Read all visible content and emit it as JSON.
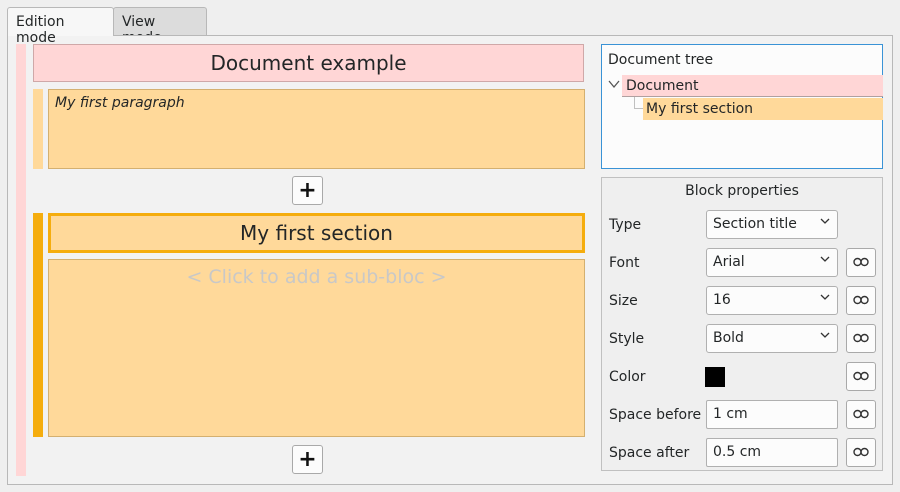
{
  "tabs": [
    {
      "label": "Edition mode"
    },
    {
      "label": "View mode"
    }
  ],
  "document": {
    "title": "Document example",
    "paragraph": "My first paragraph",
    "add_button_label": "+",
    "section": {
      "title": "My first section",
      "placeholder": "< Click to add a sub-bloc >"
    }
  },
  "tree": {
    "header": "Document tree",
    "items": [
      {
        "label": "Document"
      },
      {
        "label": "My first section"
      }
    ]
  },
  "properties": {
    "title": "Block properties",
    "rows": [
      {
        "label": "Type",
        "value": "Section title"
      },
      {
        "label": "Font",
        "value": "Arial"
      },
      {
        "label": "Size",
        "value": "16"
      },
      {
        "label": "Style",
        "value": "Bold"
      },
      {
        "label": "Color",
        "value": "#000000"
      },
      {
        "label": "Space before",
        "value": "1 cm"
      },
      {
        "label": "Space after",
        "value": "0.5 cm"
      }
    ]
  },
  "colors": {
    "document_block": "#ffd6d6",
    "paragraph_block": "#ffd99a",
    "section_accent": "#f5ad0e",
    "tree_focus": "#3a93d6"
  }
}
